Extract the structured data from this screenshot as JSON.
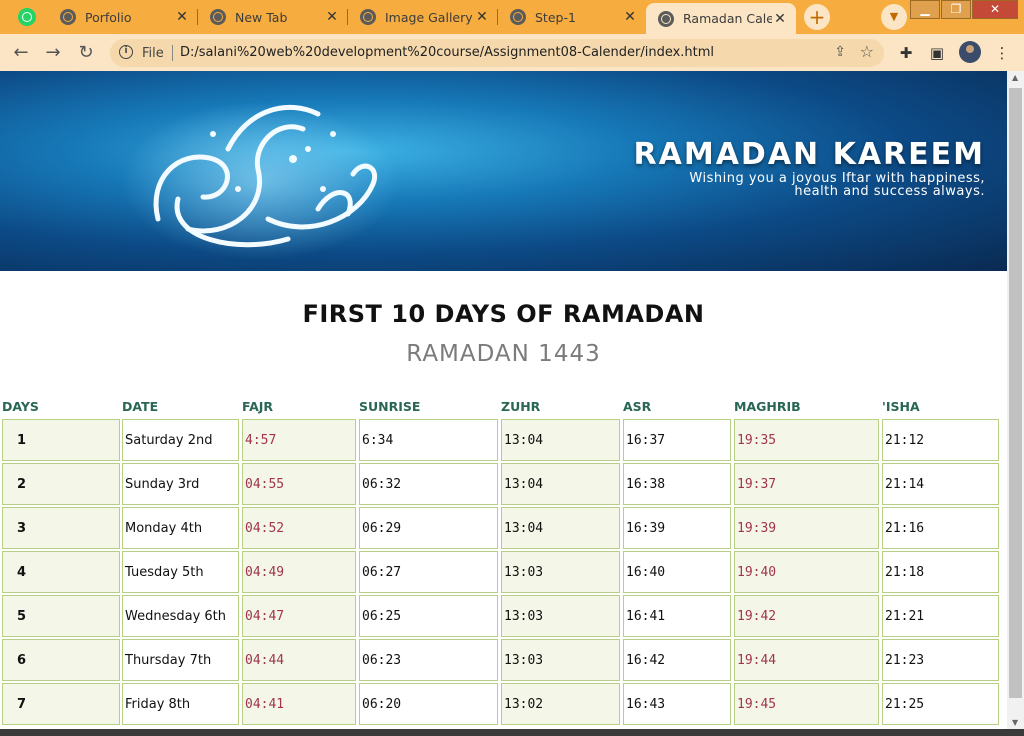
{
  "browser": {
    "tabs": [
      {
        "title": "",
        "icon": "whatsapp-icon"
      },
      {
        "title": "Porfolio",
        "icon": "globe-icon"
      },
      {
        "title": "New Tab",
        "icon": "chrome-icon"
      },
      {
        "title": "Image Gallery",
        "icon": "globe-icon"
      },
      {
        "title": "Step-1",
        "icon": "globe-icon"
      },
      {
        "title": "Ramadan Calen",
        "icon": "globe-icon",
        "active": true
      }
    ],
    "file_label": "File",
    "url": "D:/salani%20web%20development%20course/Assignment08-Calender/index.html"
  },
  "banner": {
    "title": "RAMADAN KAREEM",
    "subtitle_line1": "Wishing you a joyous Iftar with happiness,",
    "subtitle_line2": "health and success always."
  },
  "heading": "FIRST 10 DAYS OF RAMADAN",
  "subheading": "RAMADAN 1443",
  "table": {
    "headers": [
      "DAYS",
      "DATE",
      "FAJR",
      "SUNRISE",
      "ZUHR",
      "ASR",
      "MAGHRIB",
      "'ISHA"
    ],
    "rows": [
      [
        "1",
        "Saturday 2nd",
        "4:57",
        "6:34",
        "13:04",
        "16:37",
        "19:35",
        "21:12"
      ],
      [
        "2",
        "Sunday 3rd",
        "04:55",
        "06:32",
        "13:04",
        "16:38",
        "19:37",
        "21:14"
      ],
      [
        "3",
        "Monday 4th",
        "04:52",
        "06:29",
        "13:04",
        "16:39",
        "19:39",
        "21:16"
      ],
      [
        "4",
        "Tuesday 5th",
        "04:49",
        "06:27",
        "13:03",
        "16:40",
        "19:40",
        "21:18"
      ],
      [
        "5",
        "Wednesday 6th",
        "04:47",
        "06:25",
        "13:03",
        "16:41",
        "19:42",
        "21:21"
      ],
      [
        "6",
        "Thursday 7th",
        "04:44",
        "06:23",
        "13:03",
        "16:42",
        "19:44",
        "21:23"
      ],
      [
        "7",
        "Friday 8th",
        "04:41",
        "06:20",
        "13:02",
        "16:43",
        "19:45",
        "21:25"
      ]
    ]
  },
  "colors": {
    "tabbar": "#f6ac3e",
    "toolbar": "#fbe5c4",
    "header_text": "#2a6656",
    "prayer_red": "#a2344b",
    "cell_border": "#b6cf84",
    "cell_shade": "#f4f7e8"
  }
}
